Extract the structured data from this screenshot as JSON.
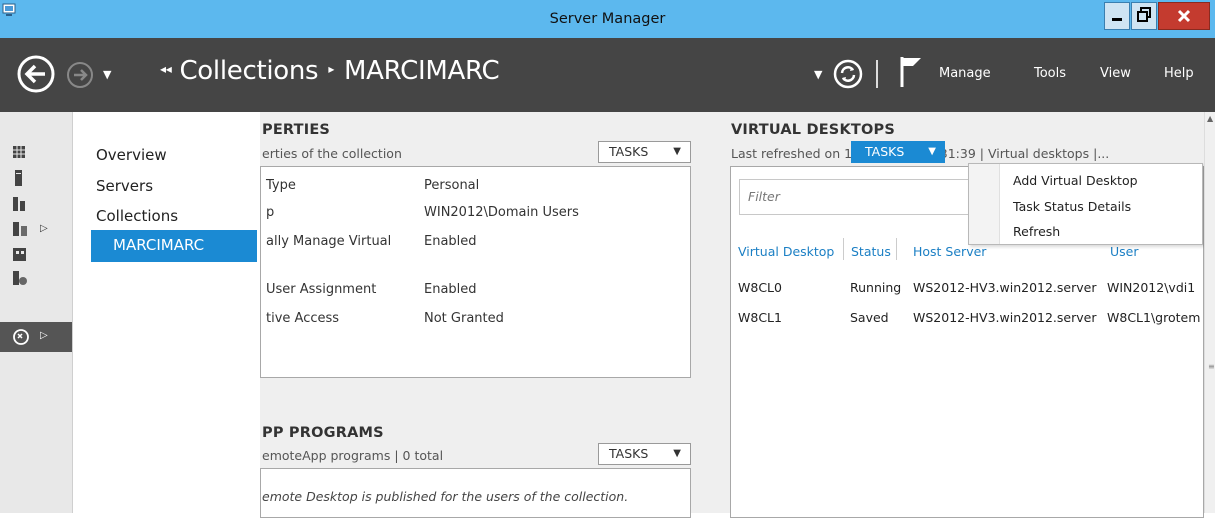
{
  "window": {
    "title": "Server Manager"
  },
  "breadcrumb": {
    "back_marker": "◂◂",
    "root": "Collections",
    "separator": "▸",
    "current": "MARCIMARC"
  },
  "menus": [
    "Manage",
    "Tools",
    "View",
    "Help"
  ],
  "nav": {
    "items": [
      "Overview",
      "Servers",
      "Collections"
    ],
    "selected": "MARCIMARC"
  },
  "rail": [
    {
      "icon": "dashboard-icon"
    },
    {
      "icon": "local-server-icon"
    },
    {
      "icon": "all-servers-icon"
    },
    {
      "icon": "file-storage-icon",
      "has_arrow": true
    },
    {
      "icon": "hyper-v-icon"
    },
    {
      "icon": "iis-icon"
    },
    {
      "icon": "remote-desktop-services-icon",
      "has_arrow": true,
      "selected": true
    }
  ],
  "properties": {
    "title": "PERTIES",
    "subtitle": "erties of the collection",
    "tasks_label": "TASKS",
    "rows": [
      {
        "label": "Type",
        "value": "Personal"
      },
      {
        "label": "p",
        "value": "WIN2012\\Domain Users"
      },
      {
        "label": "ally Manage Virtual",
        "value": "Enabled"
      },
      {
        "label": "User Assignment",
        "value": "Enabled"
      },
      {
        "label": "tive Access",
        "value": "Not Granted"
      }
    ]
  },
  "remoteapp": {
    "title": "PP PROGRAMS",
    "subtitle": "emoteApp programs | 0 total",
    "tasks_label": "TASKS",
    "message": "emote Desktop is published for the users of the collection."
  },
  "virtual_desktops": {
    "title": "VIRTUAL DESKTOPS",
    "subtitle": "Last refreshed on 13.10.2012 13:31:39 | Virtual desktops |...",
    "tasks_label": "TASKS",
    "filter_placeholder": "Filter",
    "columns": [
      "Virtual Desktop",
      "Status",
      "Host Server",
      "User"
    ],
    "rows": [
      {
        "name": "W8CL0",
        "status": "Running",
        "host": "WS2012-HV3.win2012.server",
        "user": "WIN2012\\vdi1"
      },
      {
        "name": "W8CL1",
        "status": "Saved",
        "host": "WS2012-HV3.win2012.server",
        "user": "W8CL1\\grotem"
      }
    ],
    "dropdown": [
      "Add Virtual Desktop",
      "Task Status Details",
      "Refresh"
    ]
  },
  "colors": {
    "accent": "#1b8ad3",
    "titlebar": "#5cb8ee",
    "navbar": "#454545",
    "close": "#c43b2f"
  }
}
